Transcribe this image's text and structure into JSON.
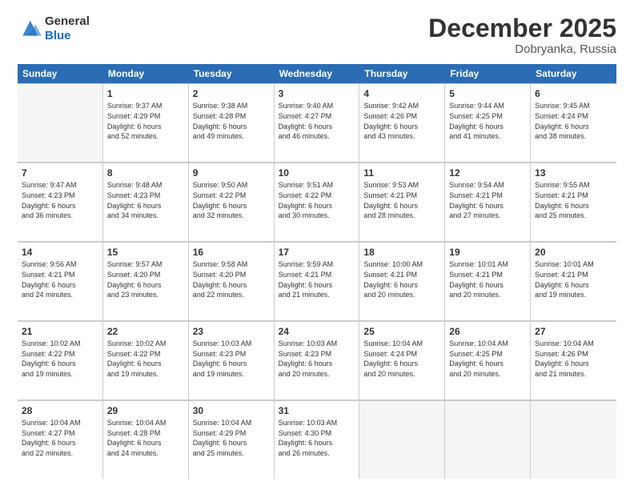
{
  "logo": {
    "general": "General",
    "blue": "Blue"
  },
  "title": "December 2025",
  "location": "Dobryanka, Russia",
  "days_header": [
    "Sunday",
    "Monday",
    "Tuesday",
    "Wednesday",
    "Thursday",
    "Friday",
    "Saturday"
  ],
  "weeks": [
    [
      {
        "day": "",
        "info": ""
      },
      {
        "day": "1",
        "info": "Sunrise: 9:37 AM\nSunset: 4:29 PM\nDaylight: 6 hours\nand 52 minutes."
      },
      {
        "day": "2",
        "info": "Sunrise: 9:38 AM\nSunset: 4:28 PM\nDaylight: 6 hours\nand 49 minutes."
      },
      {
        "day": "3",
        "info": "Sunrise: 9:40 AM\nSunset: 4:27 PM\nDaylight: 6 hours\nand 46 minutes."
      },
      {
        "day": "4",
        "info": "Sunrise: 9:42 AM\nSunset: 4:26 PM\nDaylight: 6 hours\nand 43 minutes."
      },
      {
        "day": "5",
        "info": "Sunrise: 9:44 AM\nSunset: 4:25 PM\nDaylight: 6 hours\nand 41 minutes."
      },
      {
        "day": "6",
        "info": "Sunrise: 9:45 AM\nSunset: 4:24 PM\nDaylight: 6 hours\nand 38 minutes."
      }
    ],
    [
      {
        "day": "7",
        "info": "Sunrise: 9:47 AM\nSunset: 4:23 PM\nDaylight: 6 hours\nand 36 minutes."
      },
      {
        "day": "8",
        "info": "Sunrise: 9:48 AM\nSunset: 4:23 PM\nDaylight: 6 hours\nand 34 minutes."
      },
      {
        "day": "9",
        "info": "Sunrise: 9:50 AM\nSunset: 4:22 PM\nDaylight: 6 hours\nand 32 minutes."
      },
      {
        "day": "10",
        "info": "Sunrise: 9:51 AM\nSunset: 4:22 PM\nDaylight: 6 hours\nand 30 minutes."
      },
      {
        "day": "11",
        "info": "Sunrise: 9:53 AM\nSunset: 4:21 PM\nDaylight: 6 hours\nand 28 minutes."
      },
      {
        "day": "12",
        "info": "Sunrise: 9:54 AM\nSunset: 4:21 PM\nDaylight: 6 hours\nand 27 minutes."
      },
      {
        "day": "13",
        "info": "Sunrise: 9:55 AM\nSunset: 4:21 PM\nDaylight: 6 hours\nand 25 minutes."
      }
    ],
    [
      {
        "day": "14",
        "info": "Sunrise: 9:56 AM\nSunset: 4:21 PM\nDaylight: 6 hours\nand 24 minutes."
      },
      {
        "day": "15",
        "info": "Sunrise: 9:57 AM\nSunset: 4:20 PM\nDaylight: 6 hours\nand 23 minutes."
      },
      {
        "day": "16",
        "info": "Sunrise: 9:58 AM\nSunset: 4:20 PM\nDaylight: 6 hours\nand 22 minutes."
      },
      {
        "day": "17",
        "info": "Sunrise: 9:59 AM\nSunset: 4:21 PM\nDaylight: 6 hours\nand 21 minutes."
      },
      {
        "day": "18",
        "info": "Sunrise: 10:00 AM\nSunset: 4:21 PM\nDaylight: 6 hours\nand 20 minutes."
      },
      {
        "day": "19",
        "info": "Sunrise: 10:01 AM\nSunset: 4:21 PM\nDaylight: 6 hours\nand 20 minutes."
      },
      {
        "day": "20",
        "info": "Sunrise: 10:01 AM\nSunset: 4:21 PM\nDaylight: 6 hours\nand 19 minutes."
      }
    ],
    [
      {
        "day": "21",
        "info": "Sunrise: 10:02 AM\nSunset: 4:22 PM\nDaylight: 6 hours\nand 19 minutes."
      },
      {
        "day": "22",
        "info": "Sunrise: 10:02 AM\nSunset: 4:22 PM\nDaylight: 6 hours\nand 19 minutes."
      },
      {
        "day": "23",
        "info": "Sunrise: 10:03 AM\nSunset: 4:23 PM\nDaylight: 6 hours\nand 19 minutes."
      },
      {
        "day": "24",
        "info": "Sunrise: 10:03 AM\nSunset: 4:23 PM\nDaylight: 6 hours\nand 20 minutes."
      },
      {
        "day": "25",
        "info": "Sunrise: 10:04 AM\nSunset: 4:24 PM\nDaylight: 6 hours\nand 20 minutes."
      },
      {
        "day": "26",
        "info": "Sunrise: 10:04 AM\nSunset: 4:25 PM\nDaylight: 6 hours\nand 20 minutes."
      },
      {
        "day": "27",
        "info": "Sunrise: 10:04 AM\nSunset: 4:26 PM\nDaylight: 6 hours\nand 21 minutes."
      }
    ],
    [
      {
        "day": "28",
        "info": "Sunrise: 10:04 AM\nSunset: 4:27 PM\nDaylight: 6 hours\nand 22 minutes."
      },
      {
        "day": "29",
        "info": "Sunrise: 10:04 AM\nSunset: 4:28 PM\nDaylight: 6 hours\nand 24 minutes."
      },
      {
        "day": "30",
        "info": "Sunrise: 10:04 AM\nSunset: 4:29 PM\nDaylight: 6 hours\nand 25 minutes."
      },
      {
        "day": "31",
        "info": "Sunrise: 10:03 AM\nSunset: 4:30 PM\nDaylight: 6 hours\nand 26 minutes."
      },
      {
        "day": "",
        "info": ""
      },
      {
        "day": "",
        "info": ""
      },
      {
        "day": "",
        "info": ""
      }
    ]
  ]
}
